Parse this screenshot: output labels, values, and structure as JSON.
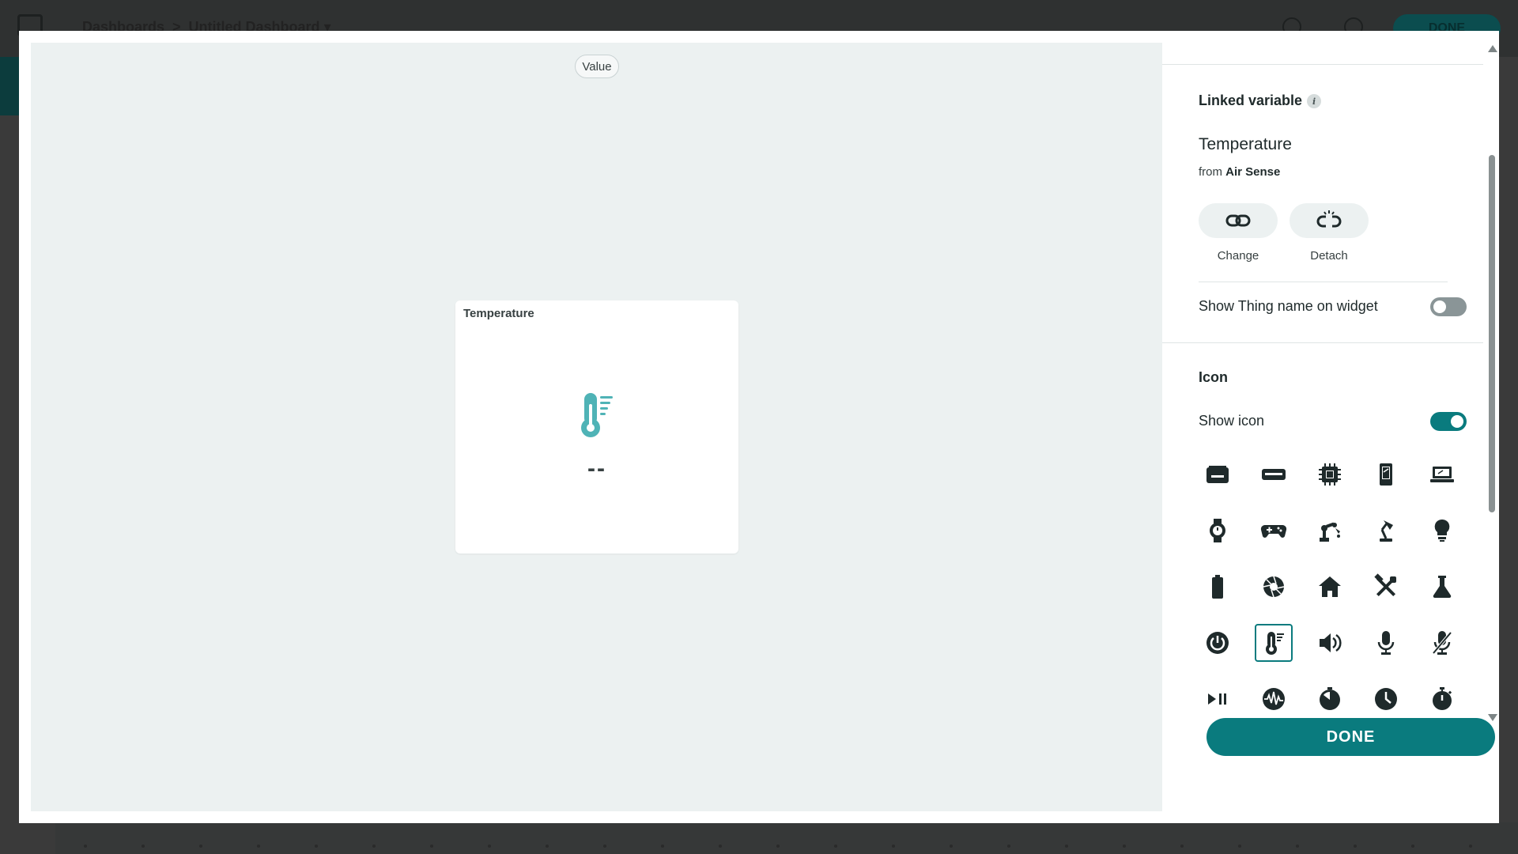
{
  "background": {
    "breadcrumb_root": "Dashboards",
    "breadcrumb_separator": ">",
    "breadcrumb_current": "Untitled Dashboard",
    "done_label": "DONE"
  },
  "preview": {
    "widget_type": "Value",
    "widget": {
      "title": "Temperature",
      "icon": "thermometer-icon",
      "value": "--"
    }
  },
  "panel": {
    "linked_variable": {
      "title": "Linked variable",
      "info_icon": "info-icon",
      "variable_name": "Temperature",
      "from_prefix": "from",
      "thing_name": "Air Sense",
      "change_label": "Change",
      "detach_label": "Detach",
      "show_thing_name_label": "Show Thing name on widget",
      "show_thing_name": false
    },
    "icon_section": {
      "title": "Icon",
      "show_icon_label": "Show icon",
      "show_icon": true,
      "selected_icon": "thermometer-icon",
      "icons": [
        "router-icon",
        "network-switch-icon",
        "chip-icon",
        "phone-icon",
        "laptop-icon",
        "watch-icon",
        "gamepad-icon",
        "robot-arm-icon",
        "desk-lamp-icon",
        "lightbulb-icon",
        "battery-icon",
        "camera-aperture-icon",
        "home-icon",
        "tools-icon",
        "flask-icon",
        "power-icon",
        "thermometer-icon",
        "speaker-icon",
        "microphone-icon",
        "microphone-off-icon",
        "play-pause-icon",
        "waveform-icon",
        "timer-icon",
        "clock-icon",
        "stopwatch-icon"
      ]
    },
    "done_label": "DONE"
  },
  "colors": {
    "accent": "#0a7b7e",
    "preview_bg": "#ecf1f1",
    "icon_color": "#1f2a2b",
    "thermometer_color": "#4fb3b6"
  }
}
